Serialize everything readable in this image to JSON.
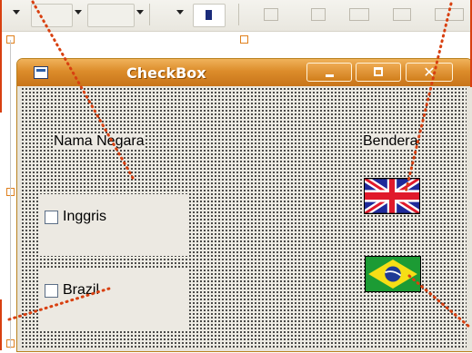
{
  "window": {
    "title": "CheckBox",
    "controls": {
      "minimize": "minimize",
      "maximize": "maximize",
      "close": "✕"
    }
  },
  "labels": {
    "header_left": "Nama Negara",
    "header_right": "Bendera"
  },
  "rows": [
    {
      "label": "Inggris",
      "checked": false,
      "flag": "uk-flag"
    },
    {
      "label": "Brazil",
      "checked": false,
      "flag": "brazil-flag"
    }
  ],
  "colors": {
    "titlebar": "#dc8c2a",
    "handle": "#e0801c",
    "selection_dots": "#d84010"
  }
}
